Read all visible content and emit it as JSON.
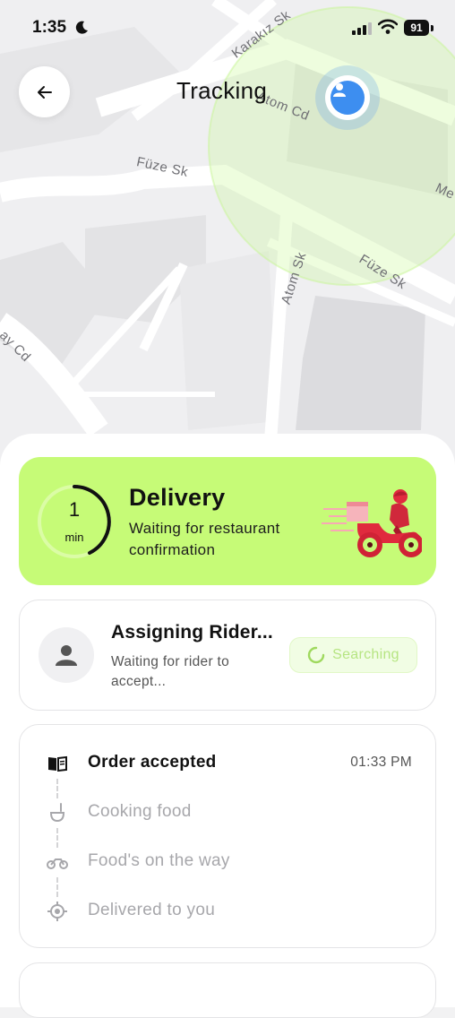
{
  "status_bar": {
    "time": "1:35",
    "battery": "91"
  },
  "header": {
    "title": "Tracking"
  },
  "map": {
    "streets": [
      "Karakız Sk",
      "Atom Cd",
      "Füze Sk",
      "Füze Sk",
      "Atom Sk",
      "Me",
      "ay Cd"
    ]
  },
  "delivery": {
    "eta_value": "1",
    "eta_unit": "min",
    "title": "Delivery",
    "subtitle": "Waiting for restaurant confirmation",
    "accent_color": "#c6fb77"
  },
  "rider": {
    "title": "Assigning Rider...",
    "subtitle": "Waiting for rider to accept...",
    "status_label": "Searching"
  },
  "timeline": {
    "steps": [
      {
        "label": "Order accepted",
        "time": "01:33 PM",
        "icon": "menu-book-icon"
      },
      {
        "label": "Cooking food",
        "time": "",
        "icon": "ladle-icon"
      },
      {
        "label": "Food's on the way",
        "time": "",
        "icon": "motorbike-icon"
      },
      {
        "label": "Delivered to you",
        "time": "",
        "icon": "location-target-icon"
      }
    ]
  }
}
